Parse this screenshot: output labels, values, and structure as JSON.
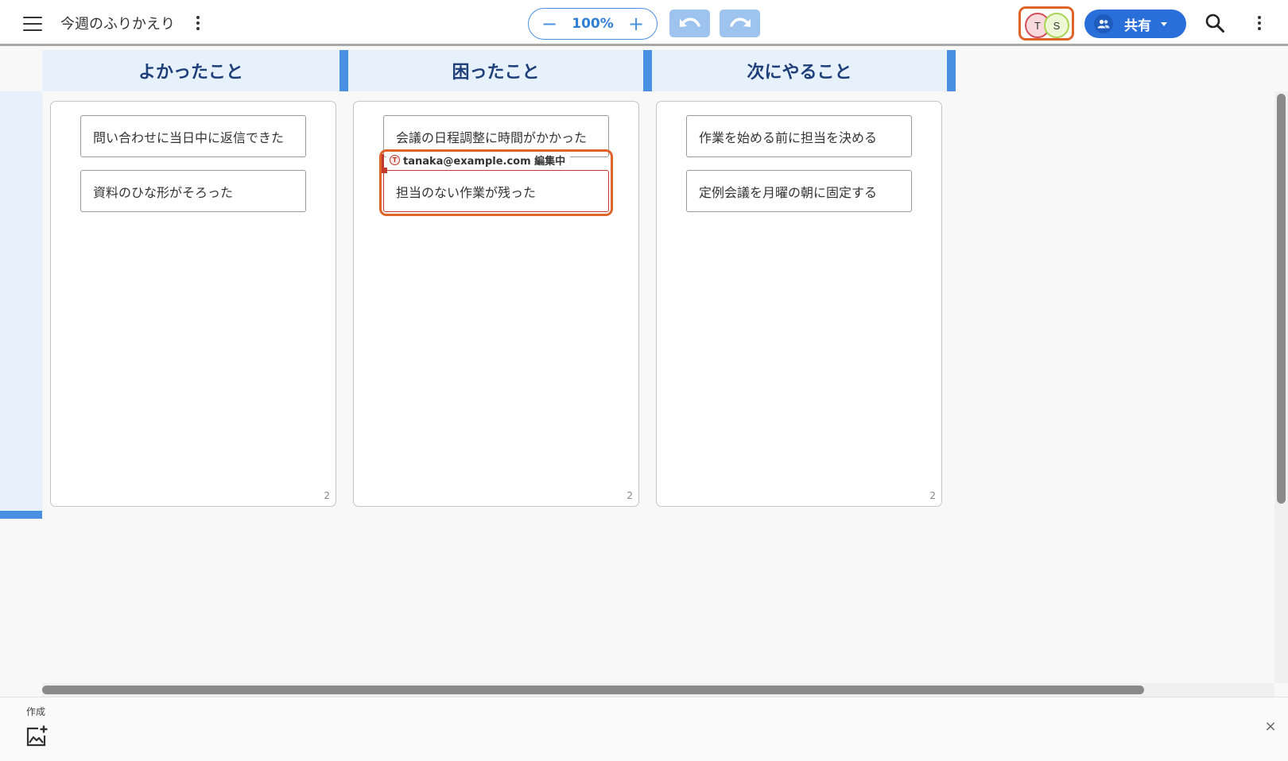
{
  "header": {
    "board_title": "今週のふりかえり",
    "zoom": {
      "minus_label": "−",
      "value": "100%",
      "plus_label": "+"
    },
    "presence": [
      {
        "initial": "T",
        "color": "#d44e5b"
      },
      {
        "initial": "S",
        "color": "#a8d552"
      }
    ],
    "share_label": "共有"
  },
  "columns": [
    {
      "title": "よかったこと",
      "count": "2",
      "cards": [
        "問い合わせに当日中に返信できた",
        "資料のひな形がそろった"
      ]
    },
    {
      "title": "困ったこと",
      "count": "2",
      "cards": [
        "会議の日程調整に時間がかかった",
        "担当のない作業が残った"
      ]
    },
    {
      "title": "次にやること",
      "count": "2",
      "cards": [
        "作業を始める前に担当を決める",
        "定例会議を月曜の朝に固定する"
      ]
    }
  ],
  "editing": {
    "avatar_initial": "T",
    "label": "tanaka@example.com 編集中"
  },
  "bottom_panel": {
    "create_label": "作成",
    "close_label": "×"
  },
  "colors": {
    "accent": "#4a90e2",
    "header_bg": "#e6f1fb",
    "editing_highlight": "#e0642a",
    "share_button": "#2a6fd9"
  },
  "icons": [
    "menu-icon",
    "more-vert-icon",
    "undo-icon",
    "redo-icon",
    "people-icon",
    "dropdown-caret-icon",
    "search-icon",
    "add-image-icon",
    "close-icon"
  ]
}
